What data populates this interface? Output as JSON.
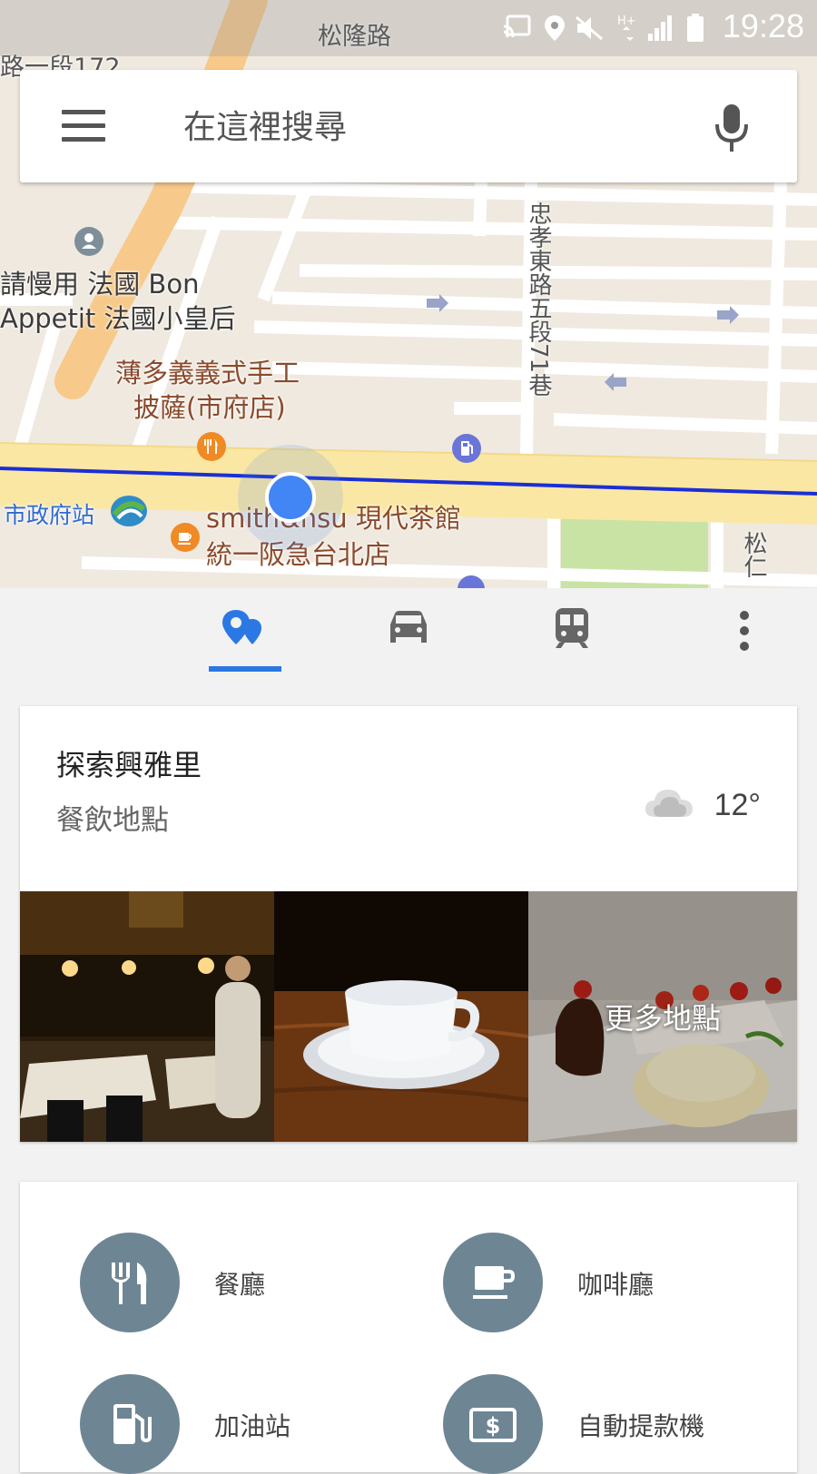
{
  "status_bar": {
    "time": "19:28"
  },
  "search": {
    "placeholder": "在這裡搜尋"
  },
  "map": {
    "labels": {
      "street_top": "松隆路",
      "street_topleft": "路一段172",
      "street_alley": "忠孝東路五段71巷",
      "street_right": "松仁",
      "poi_bon_1": "請慢用 法國 Bon",
      "poi_bon_2": "Appetit 法國小皇后",
      "poi_pizza_1": "薄多義義式手工",
      "poi_pizza_2": "披薩(市府店)",
      "station": "市政府站",
      "poi_tea_1": "smith&hsu 現代茶館",
      "poi_tea_2": "統一阪急台北店"
    }
  },
  "tabs": [
    {
      "name": "explore",
      "icon": "explore-pin-icon",
      "active": true
    },
    {
      "name": "driving",
      "icon": "car-icon"
    },
    {
      "name": "transit",
      "icon": "train-icon"
    },
    {
      "name": "more",
      "icon": "more-vert-icon"
    }
  ],
  "explore": {
    "title": "探索興雅里",
    "subtitle": "餐飲地點",
    "weather": {
      "icon": "cloud-icon",
      "temp": "12°"
    },
    "more_places": "更多地點"
  },
  "categories": [
    {
      "label": "餐廳",
      "icon": "restaurant-icon"
    },
    {
      "label": "咖啡廳",
      "icon": "coffee-icon"
    },
    {
      "label": "加油站",
      "icon": "gas-station-icon"
    },
    {
      "label": "自動提款機",
      "icon": "atm-icon"
    }
  ],
  "colors": {
    "accent": "#2b78e4",
    "category_circle": "#6e8594",
    "map_bg": "#efe9df",
    "highway": "#f7c98a",
    "main_road": "#fbe7a4",
    "park": "#c9e3a4"
  }
}
